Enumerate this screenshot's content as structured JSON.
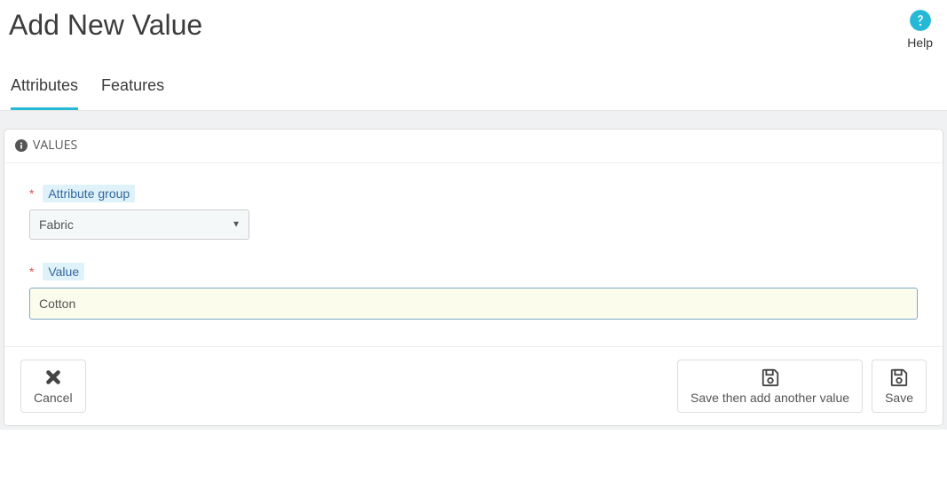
{
  "header": {
    "title": "Add New Value",
    "help_label": "Help"
  },
  "tabs": {
    "attributes": "Attributes",
    "features": "Features"
  },
  "panel": {
    "heading": "VALUES"
  },
  "form": {
    "attribute_group_label": "Attribute group",
    "attribute_group_value": "Fabric",
    "value_label": "Value",
    "value_input": "Cotton"
  },
  "buttons": {
    "cancel": "Cancel",
    "save_add_another": "Save then add another value",
    "save": "Save"
  }
}
